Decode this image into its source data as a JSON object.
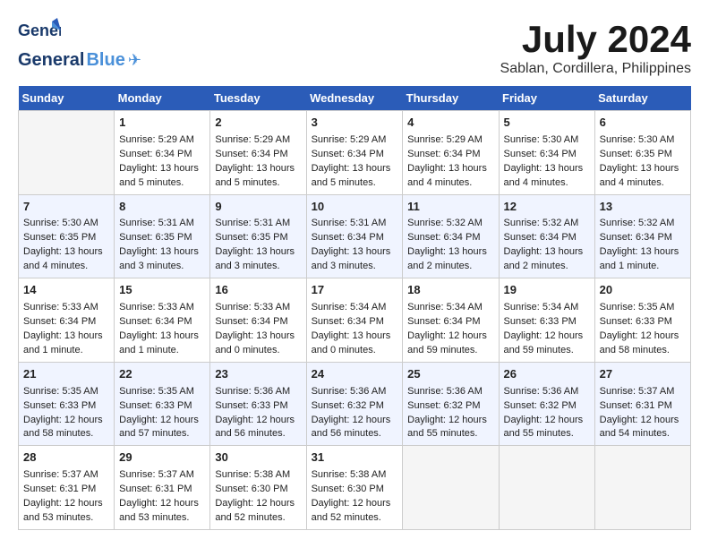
{
  "header": {
    "logo_line1": "General",
    "logo_line2": "Blue",
    "month_year": "July 2024",
    "location": "Sablan, Cordillera, Philippines"
  },
  "columns": [
    "Sunday",
    "Monday",
    "Tuesday",
    "Wednesday",
    "Thursday",
    "Friday",
    "Saturday"
  ],
  "weeks": [
    [
      {
        "day": "",
        "info": ""
      },
      {
        "day": "1",
        "info": "Sunrise: 5:29 AM\nSunset: 6:34 PM\nDaylight: 13 hours\nand 5 minutes."
      },
      {
        "day": "2",
        "info": "Sunrise: 5:29 AM\nSunset: 6:34 PM\nDaylight: 13 hours\nand 5 minutes."
      },
      {
        "day": "3",
        "info": "Sunrise: 5:29 AM\nSunset: 6:34 PM\nDaylight: 13 hours\nand 5 minutes."
      },
      {
        "day": "4",
        "info": "Sunrise: 5:29 AM\nSunset: 6:34 PM\nDaylight: 13 hours\nand 4 minutes."
      },
      {
        "day": "5",
        "info": "Sunrise: 5:30 AM\nSunset: 6:34 PM\nDaylight: 13 hours\nand 4 minutes."
      },
      {
        "day": "6",
        "info": "Sunrise: 5:30 AM\nSunset: 6:35 PM\nDaylight: 13 hours\nand 4 minutes."
      }
    ],
    [
      {
        "day": "7",
        "info": "Sunrise: 5:30 AM\nSunset: 6:35 PM\nDaylight: 13 hours\nand 4 minutes."
      },
      {
        "day": "8",
        "info": "Sunrise: 5:31 AM\nSunset: 6:35 PM\nDaylight: 13 hours\nand 3 minutes."
      },
      {
        "day": "9",
        "info": "Sunrise: 5:31 AM\nSunset: 6:35 PM\nDaylight: 13 hours\nand 3 minutes."
      },
      {
        "day": "10",
        "info": "Sunrise: 5:31 AM\nSunset: 6:34 PM\nDaylight: 13 hours\nand 3 minutes."
      },
      {
        "day": "11",
        "info": "Sunrise: 5:32 AM\nSunset: 6:34 PM\nDaylight: 13 hours\nand 2 minutes."
      },
      {
        "day": "12",
        "info": "Sunrise: 5:32 AM\nSunset: 6:34 PM\nDaylight: 13 hours\nand 2 minutes."
      },
      {
        "day": "13",
        "info": "Sunrise: 5:32 AM\nSunset: 6:34 PM\nDaylight: 13 hours\nand 1 minute."
      }
    ],
    [
      {
        "day": "14",
        "info": "Sunrise: 5:33 AM\nSunset: 6:34 PM\nDaylight: 13 hours\nand 1 minute."
      },
      {
        "day": "15",
        "info": "Sunrise: 5:33 AM\nSunset: 6:34 PM\nDaylight: 13 hours\nand 1 minute."
      },
      {
        "day": "16",
        "info": "Sunrise: 5:33 AM\nSunset: 6:34 PM\nDaylight: 13 hours\nand 0 minutes."
      },
      {
        "day": "17",
        "info": "Sunrise: 5:34 AM\nSunset: 6:34 PM\nDaylight: 13 hours\nand 0 minutes."
      },
      {
        "day": "18",
        "info": "Sunrise: 5:34 AM\nSunset: 6:34 PM\nDaylight: 12 hours\nand 59 minutes."
      },
      {
        "day": "19",
        "info": "Sunrise: 5:34 AM\nSunset: 6:33 PM\nDaylight: 12 hours\nand 59 minutes."
      },
      {
        "day": "20",
        "info": "Sunrise: 5:35 AM\nSunset: 6:33 PM\nDaylight: 12 hours\nand 58 minutes."
      }
    ],
    [
      {
        "day": "21",
        "info": "Sunrise: 5:35 AM\nSunset: 6:33 PM\nDaylight: 12 hours\nand 58 minutes."
      },
      {
        "day": "22",
        "info": "Sunrise: 5:35 AM\nSunset: 6:33 PM\nDaylight: 12 hours\nand 57 minutes."
      },
      {
        "day": "23",
        "info": "Sunrise: 5:36 AM\nSunset: 6:33 PM\nDaylight: 12 hours\nand 56 minutes."
      },
      {
        "day": "24",
        "info": "Sunrise: 5:36 AM\nSunset: 6:32 PM\nDaylight: 12 hours\nand 56 minutes."
      },
      {
        "day": "25",
        "info": "Sunrise: 5:36 AM\nSunset: 6:32 PM\nDaylight: 12 hours\nand 55 minutes."
      },
      {
        "day": "26",
        "info": "Sunrise: 5:36 AM\nSunset: 6:32 PM\nDaylight: 12 hours\nand 55 minutes."
      },
      {
        "day": "27",
        "info": "Sunrise: 5:37 AM\nSunset: 6:31 PM\nDaylight: 12 hours\nand 54 minutes."
      }
    ],
    [
      {
        "day": "28",
        "info": "Sunrise: 5:37 AM\nSunset: 6:31 PM\nDaylight: 12 hours\nand 53 minutes."
      },
      {
        "day": "29",
        "info": "Sunrise: 5:37 AM\nSunset: 6:31 PM\nDaylight: 12 hours\nand 53 minutes."
      },
      {
        "day": "30",
        "info": "Sunrise: 5:38 AM\nSunset: 6:30 PM\nDaylight: 12 hours\nand 52 minutes."
      },
      {
        "day": "31",
        "info": "Sunrise: 5:38 AM\nSunset: 6:30 PM\nDaylight: 12 hours\nand 52 minutes."
      },
      {
        "day": "",
        "info": ""
      },
      {
        "day": "",
        "info": ""
      },
      {
        "day": "",
        "info": ""
      }
    ]
  ]
}
